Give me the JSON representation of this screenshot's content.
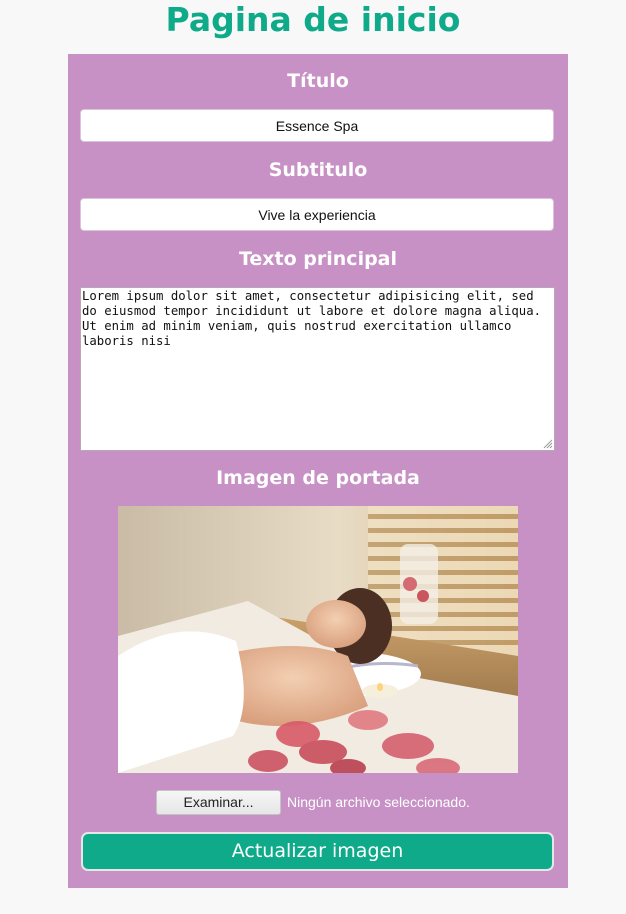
{
  "page": {
    "title": "Pagina de inicio"
  },
  "form": {
    "title_label": "Título",
    "title_value": "Essence Spa",
    "subtitle_label": "Subtitulo",
    "subtitle_value": "Vive la experiencia",
    "main_text_label": "Texto principal",
    "main_text_value": "Lorem ipsum dolor sit amet, consectetur adipisicing elit, sed do eiusmod tempor incididunt ut labore et dolore magna aliqua. Ut enim ad minim veniam, quis nostrud exercitation ullamco laboris nisi",
    "cover_label": "Imagen de portada",
    "browse_label": "Examinar...",
    "file_status": "Ningún archivo seleccionado.",
    "update_label": "Actualizar imagen"
  },
  "colors": {
    "accent": "#0eaa8a",
    "panel": "#c791c5",
    "background": "#f8f8f8"
  }
}
